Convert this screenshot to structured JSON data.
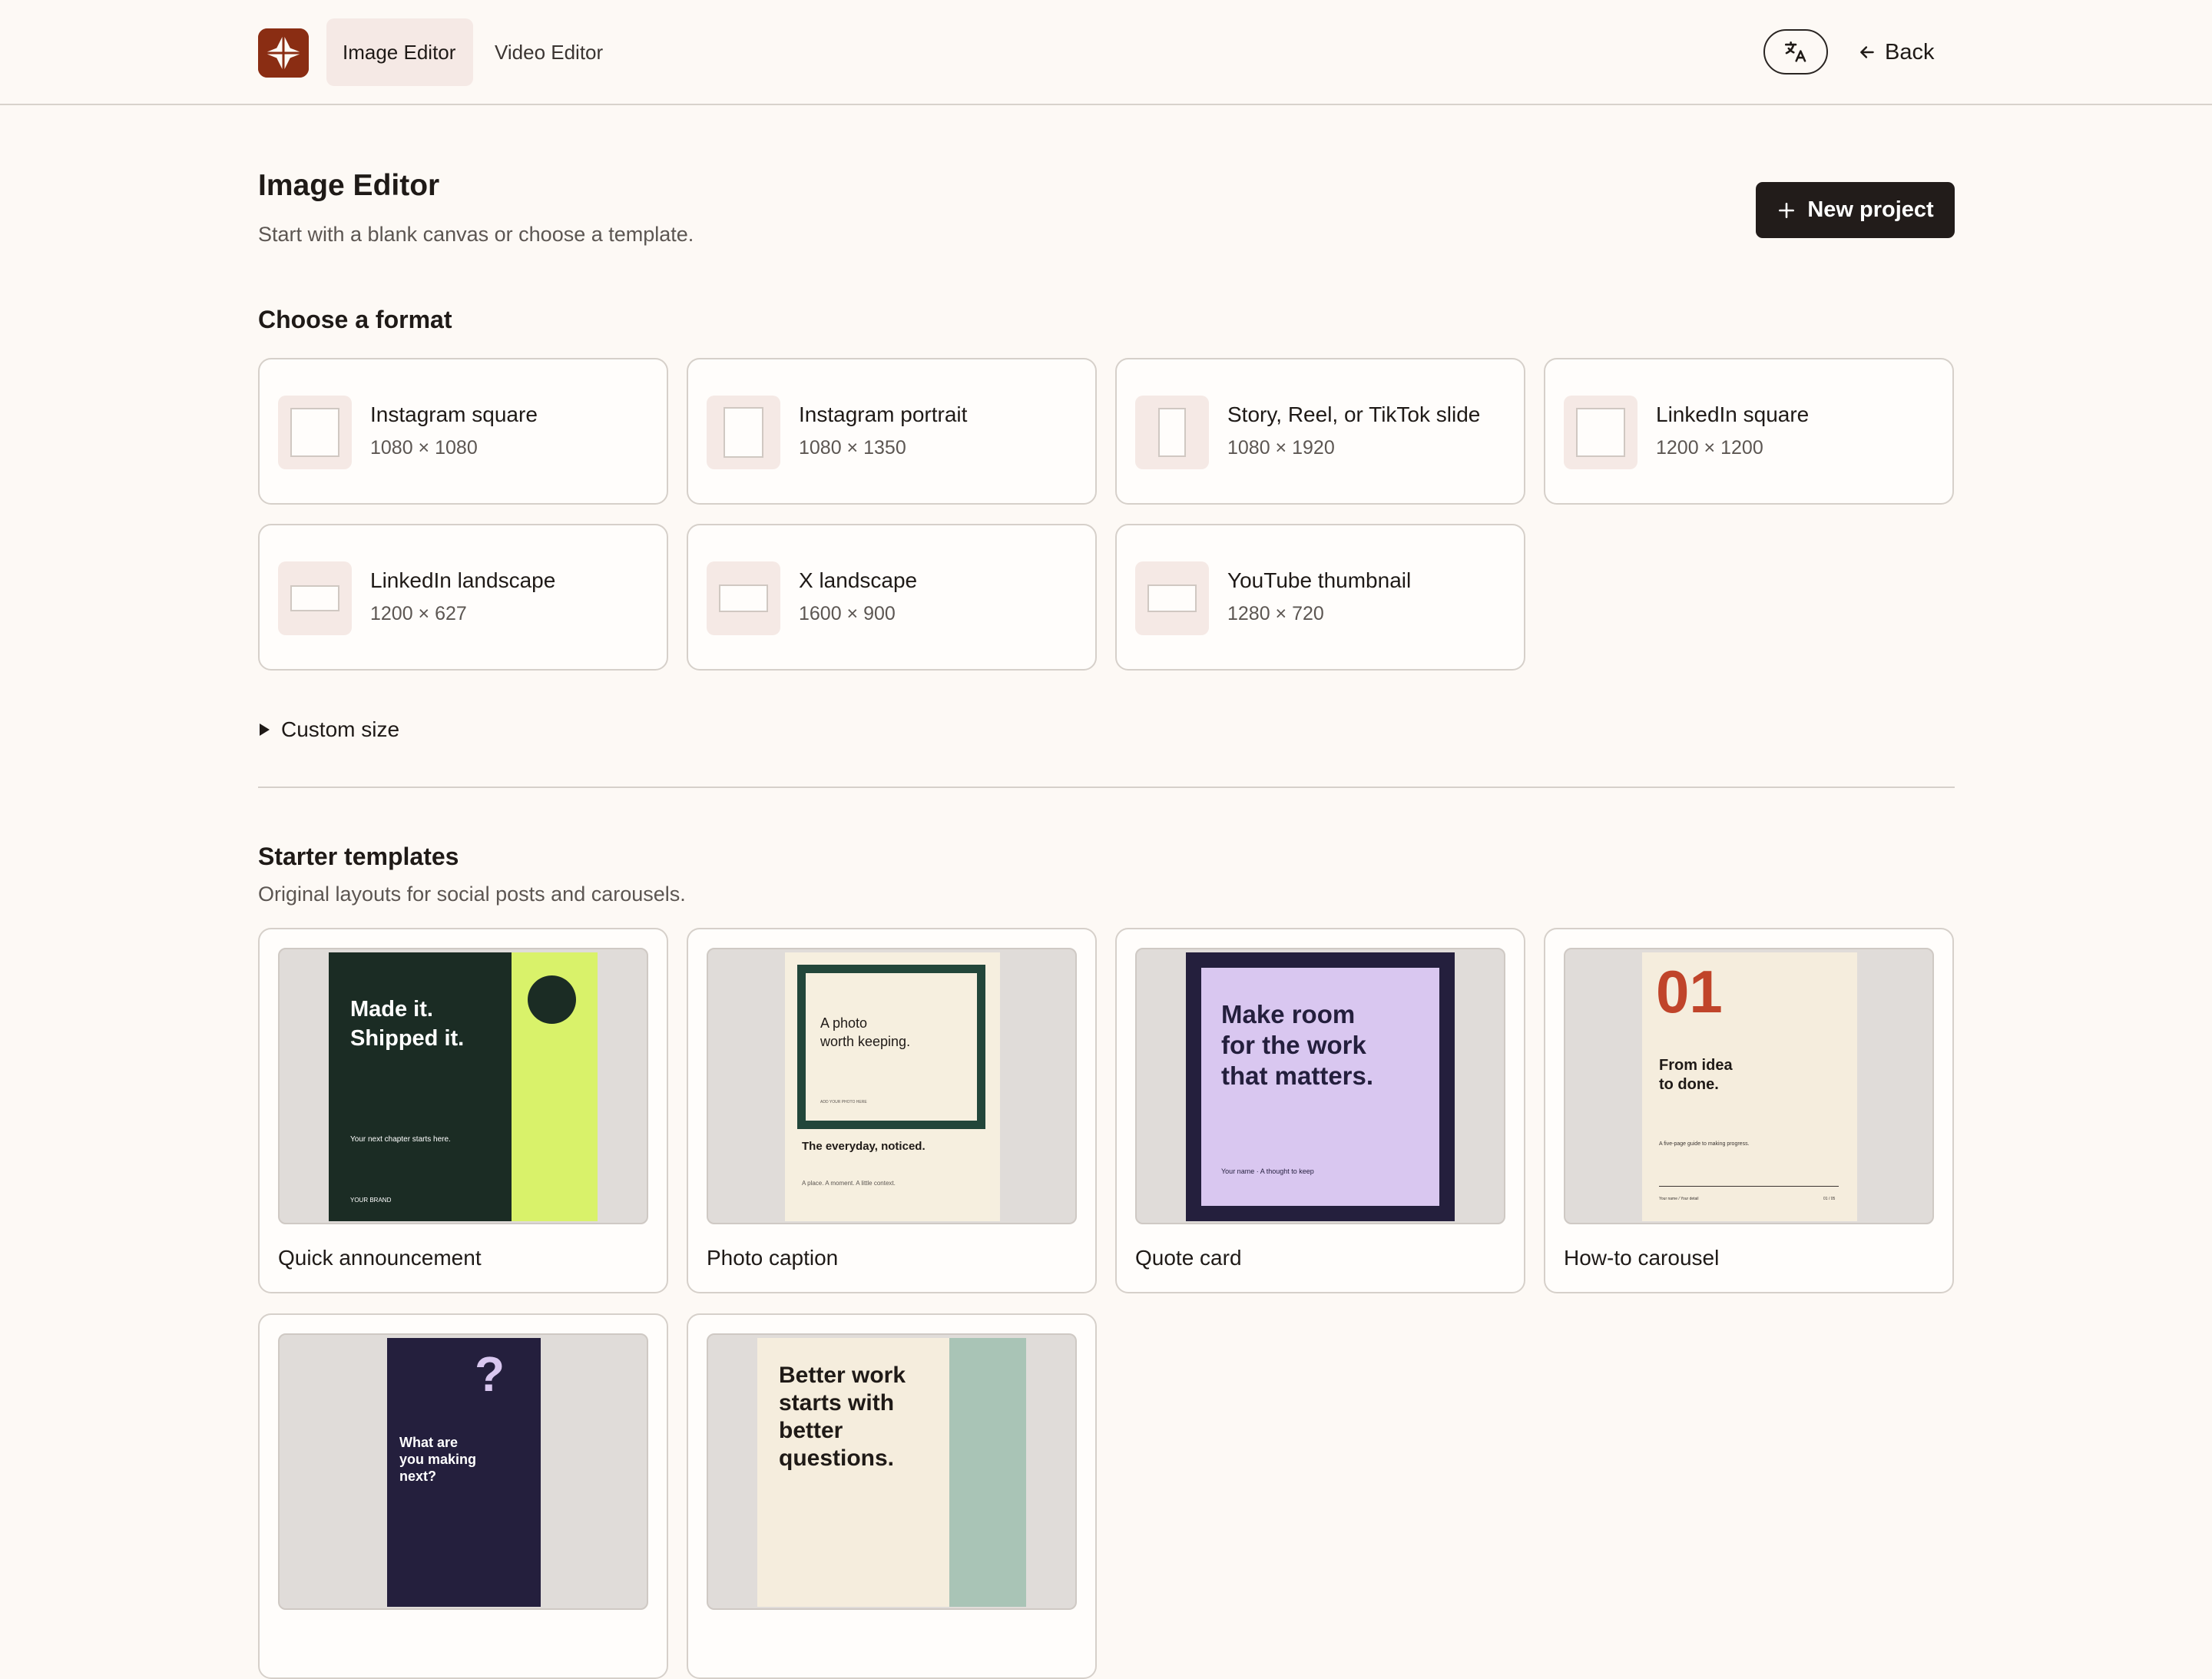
{
  "header": {
    "tabs": [
      {
        "label": "Image Editor",
        "active": true
      },
      {
        "label": "Video Editor",
        "active": false
      }
    ],
    "back_label": "Back",
    "language_icon": "translate-icon"
  },
  "page": {
    "title": "Image Editor",
    "subtitle": "Start with a blank canvas or choose a template.",
    "new_project_label": "New project"
  },
  "formats": {
    "section_title": "Choose a format",
    "items": [
      {
        "name": "Instagram square",
        "size": "1080 × 1080"
      },
      {
        "name": "Instagram portrait",
        "size": "1080 × 1350"
      },
      {
        "name": "Story, Reel, or TikTok slide",
        "size": "1080 × 1920"
      },
      {
        "name": "LinkedIn square",
        "size": "1200 × 1200"
      },
      {
        "name": "LinkedIn landscape",
        "size": "1200 × 627"
      },
      {
        "name": "X landscape",
        "size": "1600 × 900"
      },
      {
        "name": "YouTube thumbnail",
        "size": "1280 × 720"
      }
    ],
    "custom_size_label": "Custom size"
  },
  "templates": {
    "section_title": "Starter templates",
    "subtitle": "Original layouts for social posts and carousels.",
    "items": [
      {
        "name": "Quick announcement",
        "preview": {
          "headline_1": "Made it.",
          "headline_2": "Shipped it.",
          "body": "Your next chapter starts here.",
          "brand": "YOUR BRAND"
        }
      },
      {
        "name": "Photo caption",
        "preview": {
          "photo_text_1": "A photo",
          "photo_text_2": "worth keeping.",
          "photo_hint": "ADD YOUR PHOTO HERE",
          "caption": "The everyday, noticed.",
          "subcaption": "A place. A moment. A little context."
        }
      },
      {
        "name": "Quote card",
        "preview": {
          "line_1": "Make room",
          "line_2": "for the work",
          "line_3": "that matters.",
          "attribution": "Your name · A thought to keep"
        }
      },
      {
        "name": "How-to carousel",
        "preview": {
          "number": "01",
          "title_1": "From idea",
          "title_2": "to done.",
          "body": "A five-page guide to making progress.",
          "footer_left": "Your name / Your detail",
          "footer_right": "01 / 05"
        }
      },
      {
        "name": "",
        "preview": {
          "mark": "?",
          "line_1": "What are",
          "line_2": "you making",
          "line_3": "next?"
        }
      },
      {
        "name": "",
        "preview": {
          "line_1": "Better work",
          "line_2": "starts with",
          "line_3": "better",
          "line_4": "questions."
        }
      }
    ]
  },
  "colors": {
    "brand": "#8a2d13",
    "background": "#fdf9f5",
    "primary_button": "#221c1a",
    "active_tab": "#f5e9e5",
    "announcement_green": "#1b2c24",
    "announcement_lime": "#d9f26a",
    "quote_purple": "#d9c7f0",
    "quote_navy": "#241f3d",
    "carousel_red": "#c0442a"
  }
}
